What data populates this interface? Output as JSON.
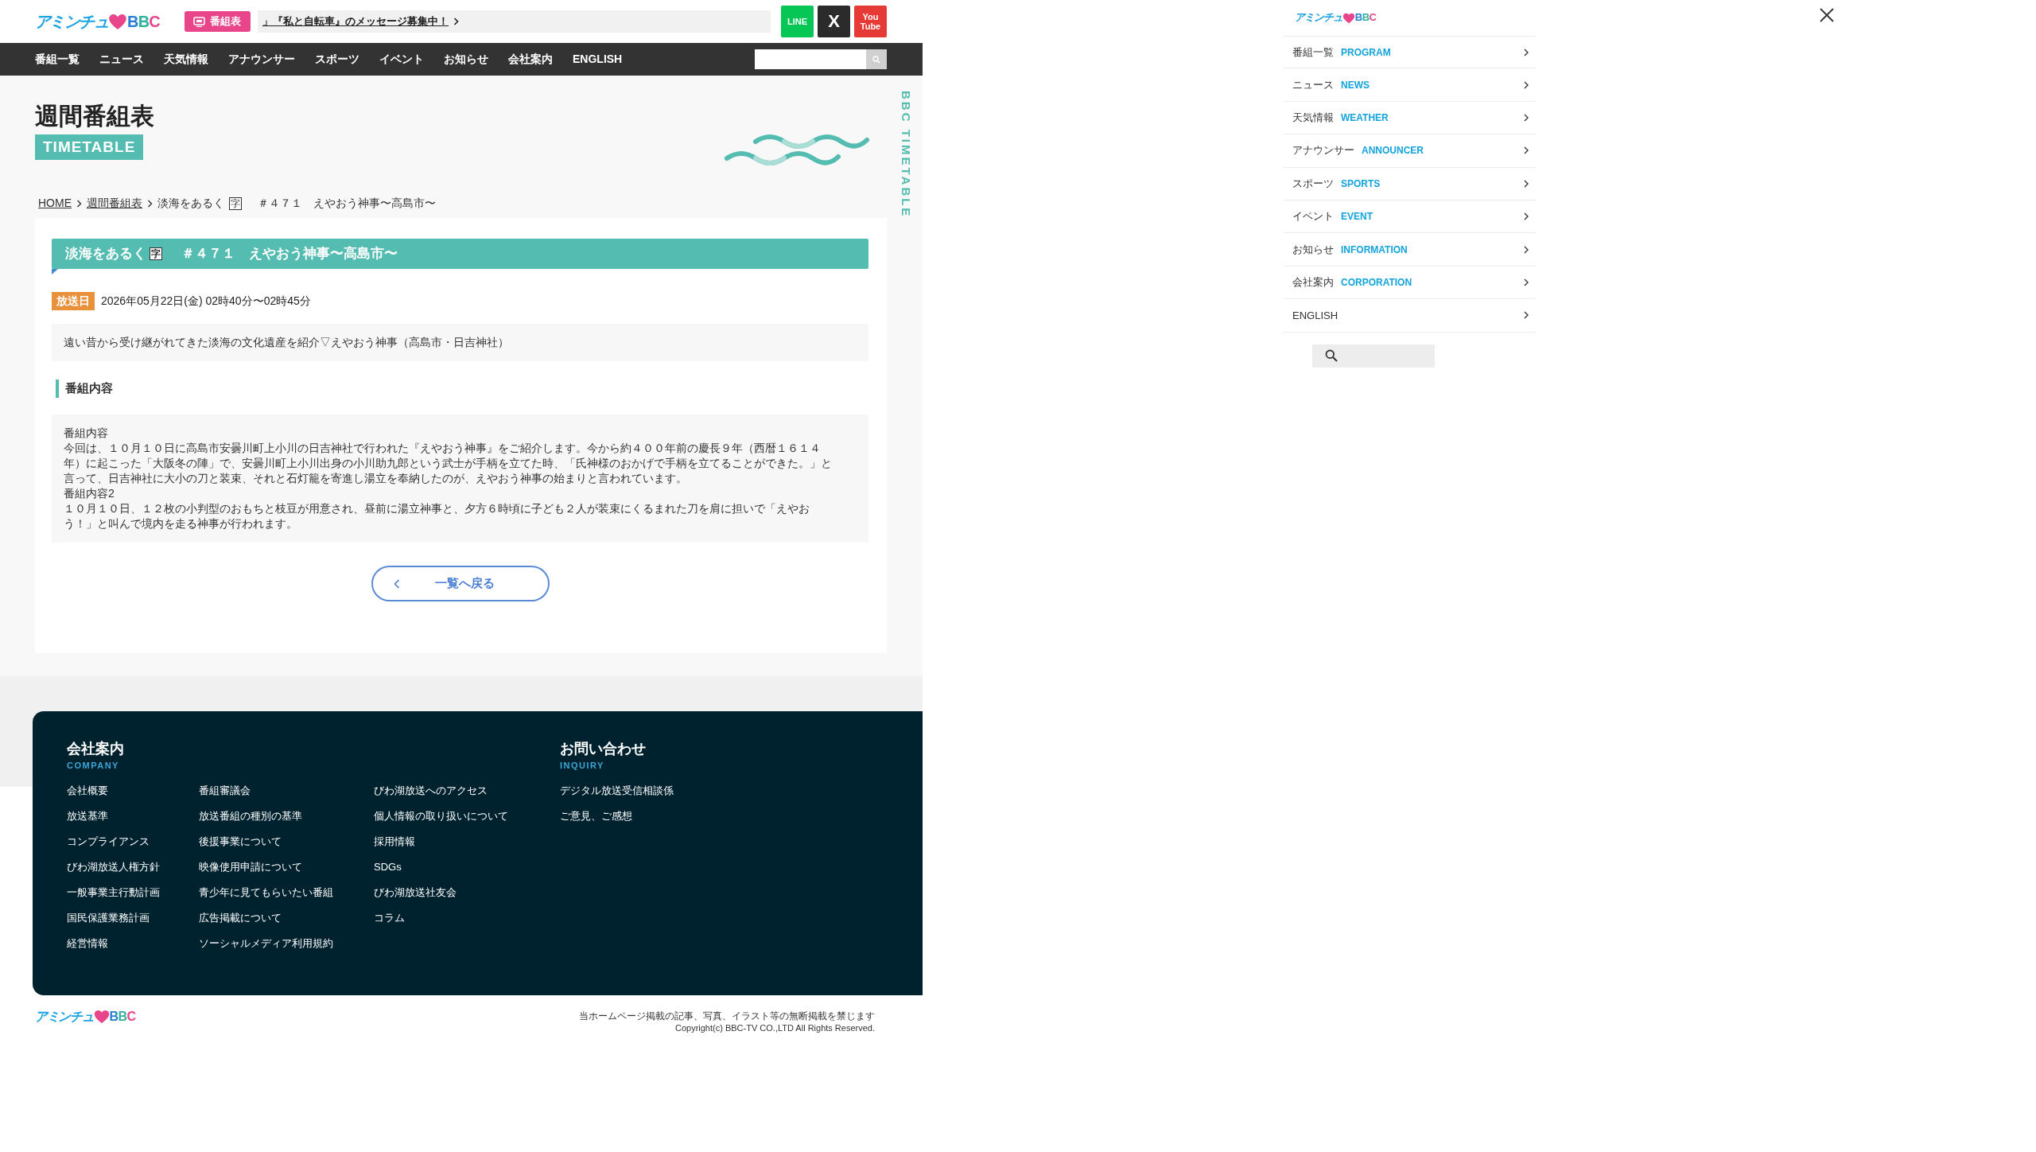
{
  "header": {
    "logo": {
      "text": "アミンチュ",
      "letters": "BBC"
    },
    "timetable_button": "番組表",
    "ticker": "」『私と自転車』のメッセージ募集中！",
    "social": [
      {
        "kind": "line",
        "label": "LINE"
      },
      {
        "kind": "x",
        "label": "X"
      },
      {
        "kind": "youtube",
        "label": "You Tube"
      }
    ]
  },
  "nav": {
    "items": [
      "番組一覧",
      "ニュース",
      "天気情報",
      "アナウンサー",
      "スポーツ",
      "イベント",
      "お知らせ",
      "会社案内",
      "ENGLISH"
    ]
  },
  "page_title": {
    "title": "週間番組表",
    "badge": "TIMETABLE",
    "side_label": "BBC TIMETABLE"
  },
  "breadcrumb": {
    "links": [
      "HOME",
      "週間番組表"
    ],
    "current": {
      "program": "淡海をあるく",
      "mark": "字",
      "episode": "＃４７１　えやおう神事〜高島市〜"
    }
  },
  "program": {
    "heading": {
      "program": "淡海をあるく",
      "mark": "字",
      "episode": "＃４７１　えやおう神事〜高島市〜"
    },
    "air_label": "放送日",
    "air_time": "2026年05月22日(金) 02時40分〜02時45分",
    "summary": "遠い昔から受け継がれてきた淡海の文化遺産を紹介▽えやおう神事（高島市・日吉神社）",
    "section_title": "番組内容",
    "content": [
      "番組内容",
      "今回は、１０月１０日に高島市安曇川町上小川の日吉神社で行われた『えやおう神事』をご紹介します。今から約４００年前の慶長９年（西暦１６１４年）に起こった「大阪冬の陣」で、安曇川町上小川出身の小川助九郎という武士が手柄を立てた時、「氏神様のおかげで手柄を立てることができた。」と言って、日吉神社に大小の刀と装束、それと石灯籠を寄進し湯立を奉納したのが、えやおう神事の始まりと言われています。",
      "番組内容2",
      "１０月１０日、１２枚の小判型のおもちと枝豆が用意され、昼前に湯立神事と、夕方６時頃に子ども２人が装束にくるまれた刀を肩に担いで「えやおう！」と叫んで境内を走る神事が行われます。"
    ],
    "back_button": "一覧へ戻る"
  },
  "footer": {
    "company": {
      "title": "会社案内",
      "subtitle": "COMPANY",
      "columns": [
        [
          "会社概要",
          "放送基準",
          "コンプライアンス",
          "びわ湖放送人権方針",
          "一般事業主行動計画",
          "国民保護業務計画",
          "経営情報"
        ],
        [
          "番組審議会",
          "放送番組の種別の基準",
          "後援事業について",
          "映像使用申請について",
          "青少年に見てもらいたい番組",
          "広告掲載について",
          "ソーシャルメディア利用規約"
        ],
        [
          "びわ湖放送へのアクセス",
          "個人情報の取り扱いについて",
          "採用情報",
          "SDGs",
          "びわ湖放送社友会",
          "コラム"
        ]
      ]
    },
    "inquiry": {
      "title": "お問い合わせ",
      "subtitle": "INQUIRY",
      "links": [
        "デジタル放送受信相談係",
        "ご意見、ご感想"
      ]
    }
  },
  "bottom": {
    "logo": {
      "text": "アミンチュ",
      "letters": "BBC"
    },
    "notice": "当ホームページ掲載の記事、写真、イラスト等の無断掲載を禁じます",
    "copyright": "Copyright(c) BBC-TV CO.,LTD All Rights Reserved."
  },
  "drawer": {
    "logo": {
      "text": "アミンチュ",
      "letters": "BBC"
    },
    "items": [
      {
        "label": "番組一覧",
        "english": "PROGRAM"
      },
      {
        "label": "ニュース",
        "english": "NEWS"
      },
      {
        "label": "天気情報",
        "english": "WEATHER"
      },
      {
        "label": "アナウンサー",
        "english": "ANNOUNCER"
      },
      {
        "label": "スポーツ",
        "english": "SPORTS"
      },
      {
        "label": "イベント",
        "english": "EVENT"
      },
      {
        "label": "お知らせ",
        "english": "INFORMATION"
      },
      {
        "label": "会社案内",
        "english": "CORPORATION"
      },
      {
        "label": "ENGLISH"
      }
    ]
  }
}
